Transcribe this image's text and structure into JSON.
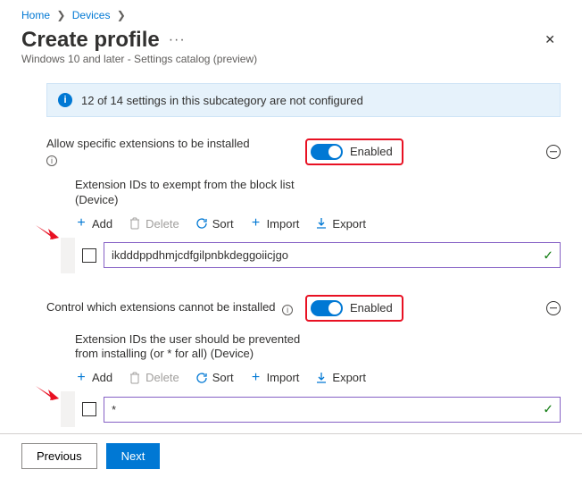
{
  "breadcrumb": {
    "home": "Home",
    "devices": "Devices"
  },
  "title": "Create profile",
  "subtitle": "Windows 10 and later - Settings catalog (preview)",
  "banner": "12 of 14 settings in this subcategory are not configured",
  "setting1": {
    "label": "Allow specific extensions to be installed",
    "toggle_label": "Enabled",
    "sub_label": "Extension IDs to exempt from the block list (Device)",
    "value": "ikdddppdhmjcdfgilpnbkdeggoiicjgo"
  },
  "setting2": {
    "label": "Control which extensions cannot be installed",
    "toggle_label": "Enabled",
    "sub_label": "Extension IDs the user should be prevented from installing (or * for all) (Device)",
    "value": "*"
  },
  "toolbar": {
    "add": "Add",
    "delete": "Delete",
    "sort": "Sort",
    "import": "Import",
    "export": "Export"
  },
  "footer": {
    "previous": "Previous",
    "next": "Next"
  }
}
